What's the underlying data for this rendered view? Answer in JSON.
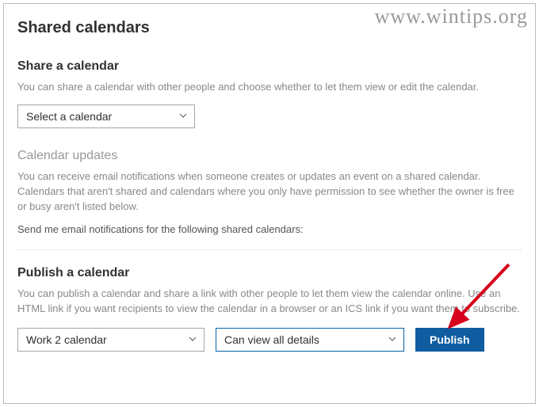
{
  "watermark": "www.wintips.org",
  "page": {
    "title": "Shared calendars"
  },
  "share": {
    "heading": "Share a calendar",
    "desc": "You can share a calendar with other people and choose whether to let them view or edit the calendar.",
    "select_value": "Select a calendar"
  },
  "updates": {
    "heading": "Calendar updates",
    "desc": "You can receive email notifications when someone creates or updates an event on a shared calendar. Calendars that aren't shared and calendars where you only have permission to see whether the owner is free or busy aren't listed below.",
    "sub_label": "Send me email notifications for the following shared calendars:"
  },
  "publish": {
    "heading": "Publish a calendar",
    "desc": "You can publish a calendar and share a link with other people to let them view the calendar online. Use an HTML link if you want recipients to view the calendar in a browser or an ICS link if you want them to subscribe.",
    "calendar_value": "Work 2 calendar",
    "permission_value": "Can view all details",
    "button_label": "Publish"
  }
}
